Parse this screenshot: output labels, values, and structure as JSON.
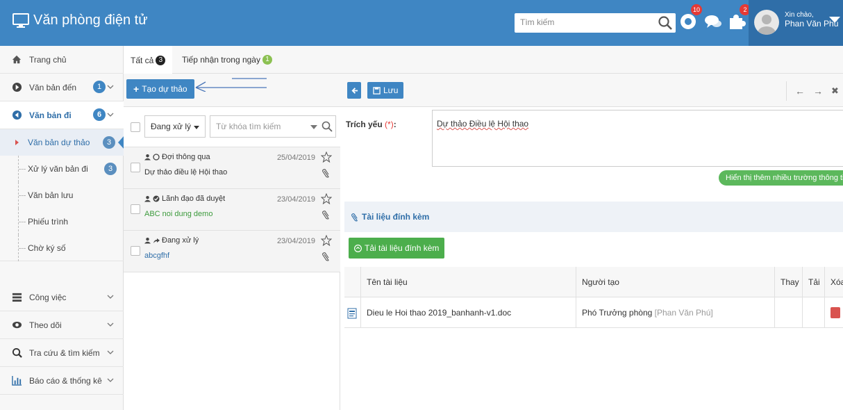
{
  "app": {
    "title": "Văn phòng điện tử"
  },
  "search": {
    "placeholder": "Tìm kiếm"
  },
  "notifications": {
    "badge1": "10",
    "badge2": "2"
  },
  "user": {
    "greeting": "Xin chào,",
    "name": "Phan Văn Phú"
  },
  "sidebar": {
    "items": [
      {
        "label": "Trang chủ",
        "icon": "home-icon"
      },
      {
        "label": "Văn bản đến",
        "count": "1",
        "icon": "arrow-circle-right-icon"
      },
      {
        "label": "Văn bản đi",
        "count": "6",
        "icon": "arrow-circle-left-icon"
      },
      {
        "label": "Công việc",
        "icon": "tasks-icon"
      },
      {
        "label": "Theo dõi",
        "icon": "eye-icon"
      },
      {
        "label": "Tra cứu & tìm kiếm",
        "icon": "search-icon"
      },
      {
        "label": "Báo cáo & thống kê",
        "icon": "bar-chart-icon"
      }
    ],
    "sub_items": [
      {
        "label": "Văn bản dự thảo",
        "count": "3"
      },
      {
        "label": "Xử lý văn bản đi",
        "count": "3"
      },
      {
        "label": "Văn bản lưu"
      },
      {
        "label": "Phiếu trình"
      },
      {
        "label": "Chờ ký số"
      }
    ]
  },
  "tabs": [
    {
      "label": "Tất cả",
      "count": "3"
    },
    {
      "label": "Tiếp nhận trong ngày",
      "count": "1"
    }
  ],
  "toolbar": {
    "create_label": "Tạo dự thảo"
  },
  "filter": {
    "status_value": "Đang xử lý",
    "keyword_placeholder": "Từ khóa tìm kiếm"
  },
  "documents": [
    {
      "status": "Đợi thông qua",
      "date": "25/04/2019",
      "title": "Dự thảo điều lệ Hội thao",
      "title_color": "#333333"
    },
    {
      "status": "Lãnh đạo đã duyệt",
      "date": "23/04/2019",
      "title": "ABC noi dung demo",
      "title_color": "#3c9a3c"
    },
    {
      "status": "Đang xử lý",
      "date": "23/04/2019",
      "title": "abcgfhf",
      "title_color": "#2f6ea8"
    }
  ],
  "detail": {
    "save_label": "Lưu",
    "summary_label": "Trích yếu",
    "summary_req": "(*)",
    "summary_colon": ":",
    "summary_value": "Dự thảo Điều lệ Hội thao",
    "more_fields_label": "Hiển thị thêm nhiều trường thông tin hơn",
    "attachments_title": "Tài liệu đính kèm",
    "upload_label": "Tải tài liệu đính kèm",
    "columns": {
      "name": "Tên tài liệu",
      "creator": "Người tạo",
      "replace": "Thay",
      "download": "Tải",
      "delete": "Xóa"
    },
    "files": [
      {
        "name": "Dieu le Hoi thao 2019_banhanh-v1.doc",
        "creator_role": "Phó Trưởng phòng",
        "creator_name": "[Phan Văn Phú]"
      }
    ]
  },
  "colors": {
    "primary": "#3f86c3",
    "success": "#5cb85c",
    "danger": "#d9534f"
  }
}
